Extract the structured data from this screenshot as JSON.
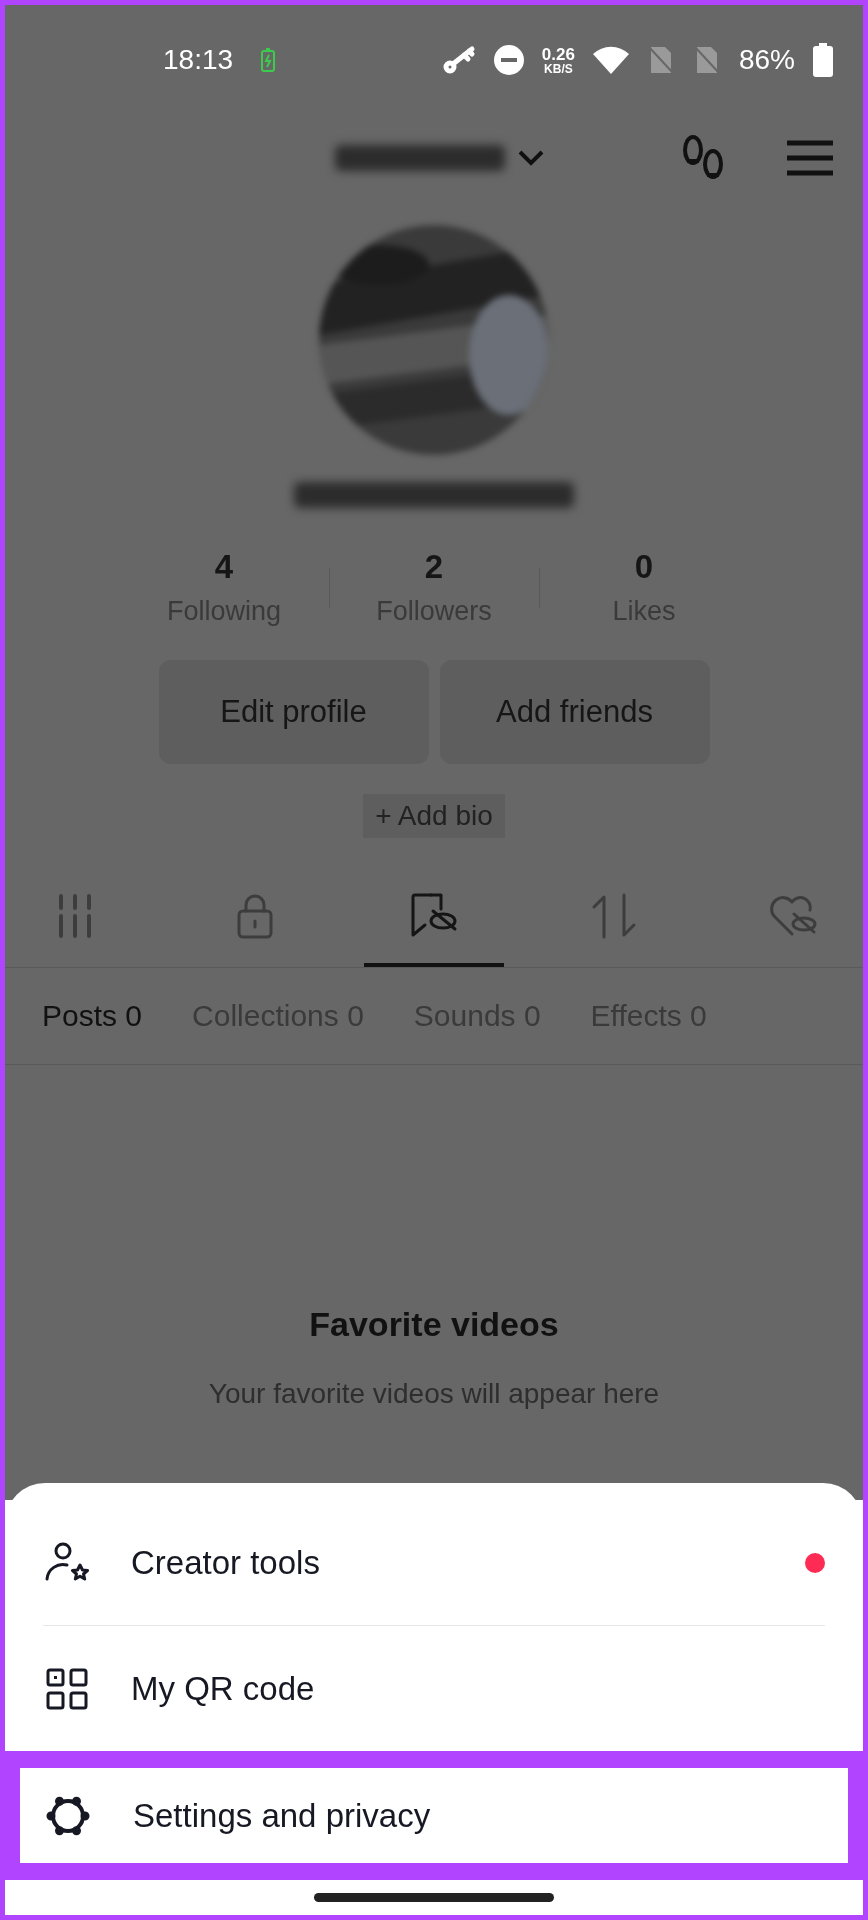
{
  "status_bar": {
    "time": "18:13",
    "speed_value": "0.26",
    "speed_unit": "KB/S",
    "battery": "86%"
  },
  "stats": [
    {
      "value": "4",
      "label": "Following"
    },
    {
      "value": "2",
      "label": "Followers"
    },
    {
      "value": "0",
      "label": "Likes"
    }
  ],
  "buttons": [
    "Edit profile",
    "Add friends"
  ],
  "add_bio": "+ Add bio",
  "icon_tabs": [
    {
      "kind": "grid",
      "selected": false
    },
    {
      "kind": "lock",
      "selected": false
    },
    {
      "kind": "bookmark",
      "selected": true
    },
    {
      "kind": "repost",
      "selected": false
    },
    {
      "kind": "heart",
      "selected": false
    }
  ],
  "sub_tabs": [
    {
      "label": "Posts 0",
      "selected": true
    },
    {
      "label": "Collections 0",
      "selected": false
    },
    {
      "label": "Sounds 0",
      "selected": false
    },
    {
      "label": "Effects 0",
      "selected": false
    }
  ],
  "empty_state": {
    "title": "Favorite videos",
    "subtitle": "Your favorite videos will appear here"
  },
  "menu": [
    {
      "kind": "creator",
      "label": "Creator tools",
      "badge": true,
      "highlighted": false
    },
    {
      "kind": "qr",
      "label": "My QR code",
      "badge": false,
      "highlighted": false
    },
    {
      "kind": "settings",
      "label": "Settings and privacy",
      "badge": false,
      "highlighted": true
    }
  ]
}
